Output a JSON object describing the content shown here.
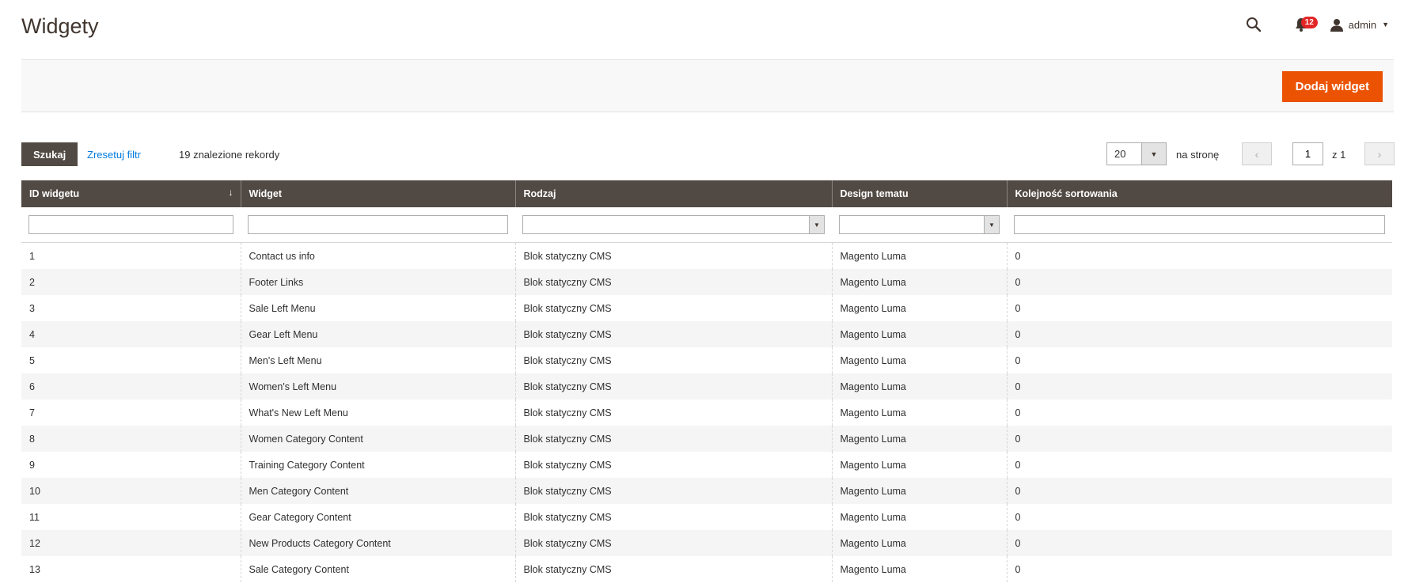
{
  "page": {
    "title": "Widgety"
  },
  "header": {
    "search_icon": "search-icon",
    "notifications": {
      "count": "12",
      "icon": "bell-icon"
    },
    "user": {
      "name": "admin",
      "icon": "user-icon"
    }
  },
  "actions": {
    "add_label": "Dodaj widget",
    "accent_color": "#eb5202"
  },
  "toolbar": {
    "search_label": "Szukaj",
    "reset_label": "Zresetuj filtr",
    "records_label": "19 znalezione rekordy",
    "per_page_value": "20",
    "per_page_label": "na stronę",
    "page_value": "1",
    "page_of": "z 1"
  },
  "grid": {
    "columns": [
      "ID widgetu",
      "Widget",
      "Rodzaj",
      "Design tematu",
      "Kolejność sortowania"
    ],
    "sorted_column": "ID widgetu",
    "filters": {
      "design_value": "Magento Luma"
    },
    "rows": [
      {
        "id": "1",
        "widget": "Contact us info",
        "type": "Blok statyczny CMS",
        "theme": "Magento Luma",
        "sort": "0"
      },
      {
        "id": "2",
        "widget": "Footer Links",
        "type": "Blok statyczny CMS",
        "theme": "Magento Luma",
        "sort": "0"
      },
      {
        "id": "3",
        "widget": "Sale Left Menu",
        "type": "Blok statyczny CMS",
        "theme": "Magento Luma",
        "sort": "0"
      },
      {
        "id": "4",
        "widget": "Gear Left Menu",
        "type": "Blok statyczny CMS",
        "theme": "Magento Luma",
        "sort": "0"
      },
      {
        "id": "5",
        "widget": "Men's Left Menu",
        "type": "Blok statyczny CMS",
        "theme": "Magento Luma",
        "sort": "0"
      },
      {
        "id": "6",
        "widget": "Women's Left Menu",
        "type": "Blok statyczny CMS",
        "theme": "Magento Luma",
        "sort": "0"
      },
      {
        "id": "7",
        "widget": "What's New Left Menu",
        "type": "Blok statyczny CMS",
        "theme": "Magento Luma",
        "sort": "0"
      },
      {
        "id": "8",
        "widget": "Women Category Content",
        "type": "Blok statyczny CMS",
        "theme": "Magento Luma",
        "sort": "0"
      },
      {
        "id": "9",
        "widget": "Training Category Content",
        "type": "Blok statyczny CMS",
        "theme": "Magento Luma",
        "sort": "0"
      },
      {
        "id": "10",
        "widget": "Men Category Content",
        "type": "Blok statyczny CMS",
        "theme": "Magento Luma",
        "sort": "0"
      },
      {
        "id": "11",
        "widget": "Gear Category Content",
        "type": "Blok statyczny CMS",
        "theme": "Magento Luma",
        "sort": "0"
      },
      {
        "id": "12",
        "widget": "New Products Category Content",
        "type": "Blok statyczny CMS",
        "theme": "Magento Luma",
        "sort": "0"
      },
      {
        "id": "13",
        "widget": "Sale Category Content",
        "type": "Blok statyczny CMS",
        "theme": "Magento Luma",
        "sort": "0"
      }
    ]
  }
}
